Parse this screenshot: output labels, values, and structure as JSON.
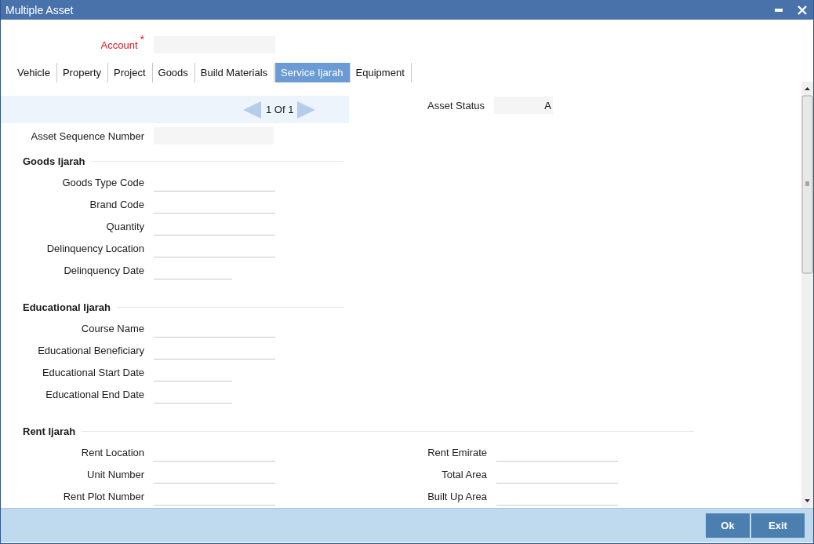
{
  "window": {
    "title": "Multiple Asset"
  },
  "account": {
    "label": "Account",
    "required_mark": "*"
  },
  "tabs": [
    {
      "label": "Vehicle",
      "selected": false
    },
    {
      "label": "Property",
      "selected": false
    },
    {
      "label": "Project",
      "selected": false
    },
    {
      "label": "Goods",
      "selected": false
    },
    {
      "label": "Build Materials",
      "selected": false
    },
    {
      "label": "Service Ijarah",
      "selected": true
    },
    {
      "label": "Equipment",
      "selected": false
    }
  ],
  "pager": {
    "text": "1 Of 1"
  },
  "asset_status": {
    "label": "Asset Status",
    "value": "A"
  },
  "asset_sequence": {
    "label": "Asset Sequence Number"
  },
  "sections": [
    {
      "title": "Goods Ijarah",
      "fields": [
        {
          "label": "Goods Type Code",
          "kind": "text"
        },
        {
          "label": "Brand Code",
          "kind": "text"
        },
        {
          "label": "Quantity",
          "kind": "text"
        },
        {
          "label": "Delinquency Location",
          "kind": "text"
        },
        {
          "label": "Delinquency Date",
          "kind": "date"
        }
      ]
    },
    {
      "title": "Educational Ijarah",
      "fields": [
        {
          "label": "Course Name",
          "kind": "text"
        },
        {
          "label": "Educational Beneficiary",
          "kind": "text"
        },
        {
          "label": "Educational Start Date",
          "kind": "date"
        },
        {
          "label": "Educational End Date",
          "kind": "date"
        }
      ]
    },
    {
      "title": "Rent Ijarah",
      "fields": [
        {
          "label": "Rent Location",
          "kind": "text"
        },
        {
          "label": "Unit Number",
          "kind": "text"
        },
        {
          "label": "Rent Plot Number",
          "kind": "text"
        }
      ],
      "right_fields": [
        {
          "label": "Rent Emirate",
          "kind": "text"
        },
        {
          "label": "Total Area",
          "kind": "text"
        },
        {
          "label": "Built Up Area",
          "kind": "text"
        }
      ]
    }
  ],
  "buttons": [
    "Ok",
    "Exit"
  ]
}
